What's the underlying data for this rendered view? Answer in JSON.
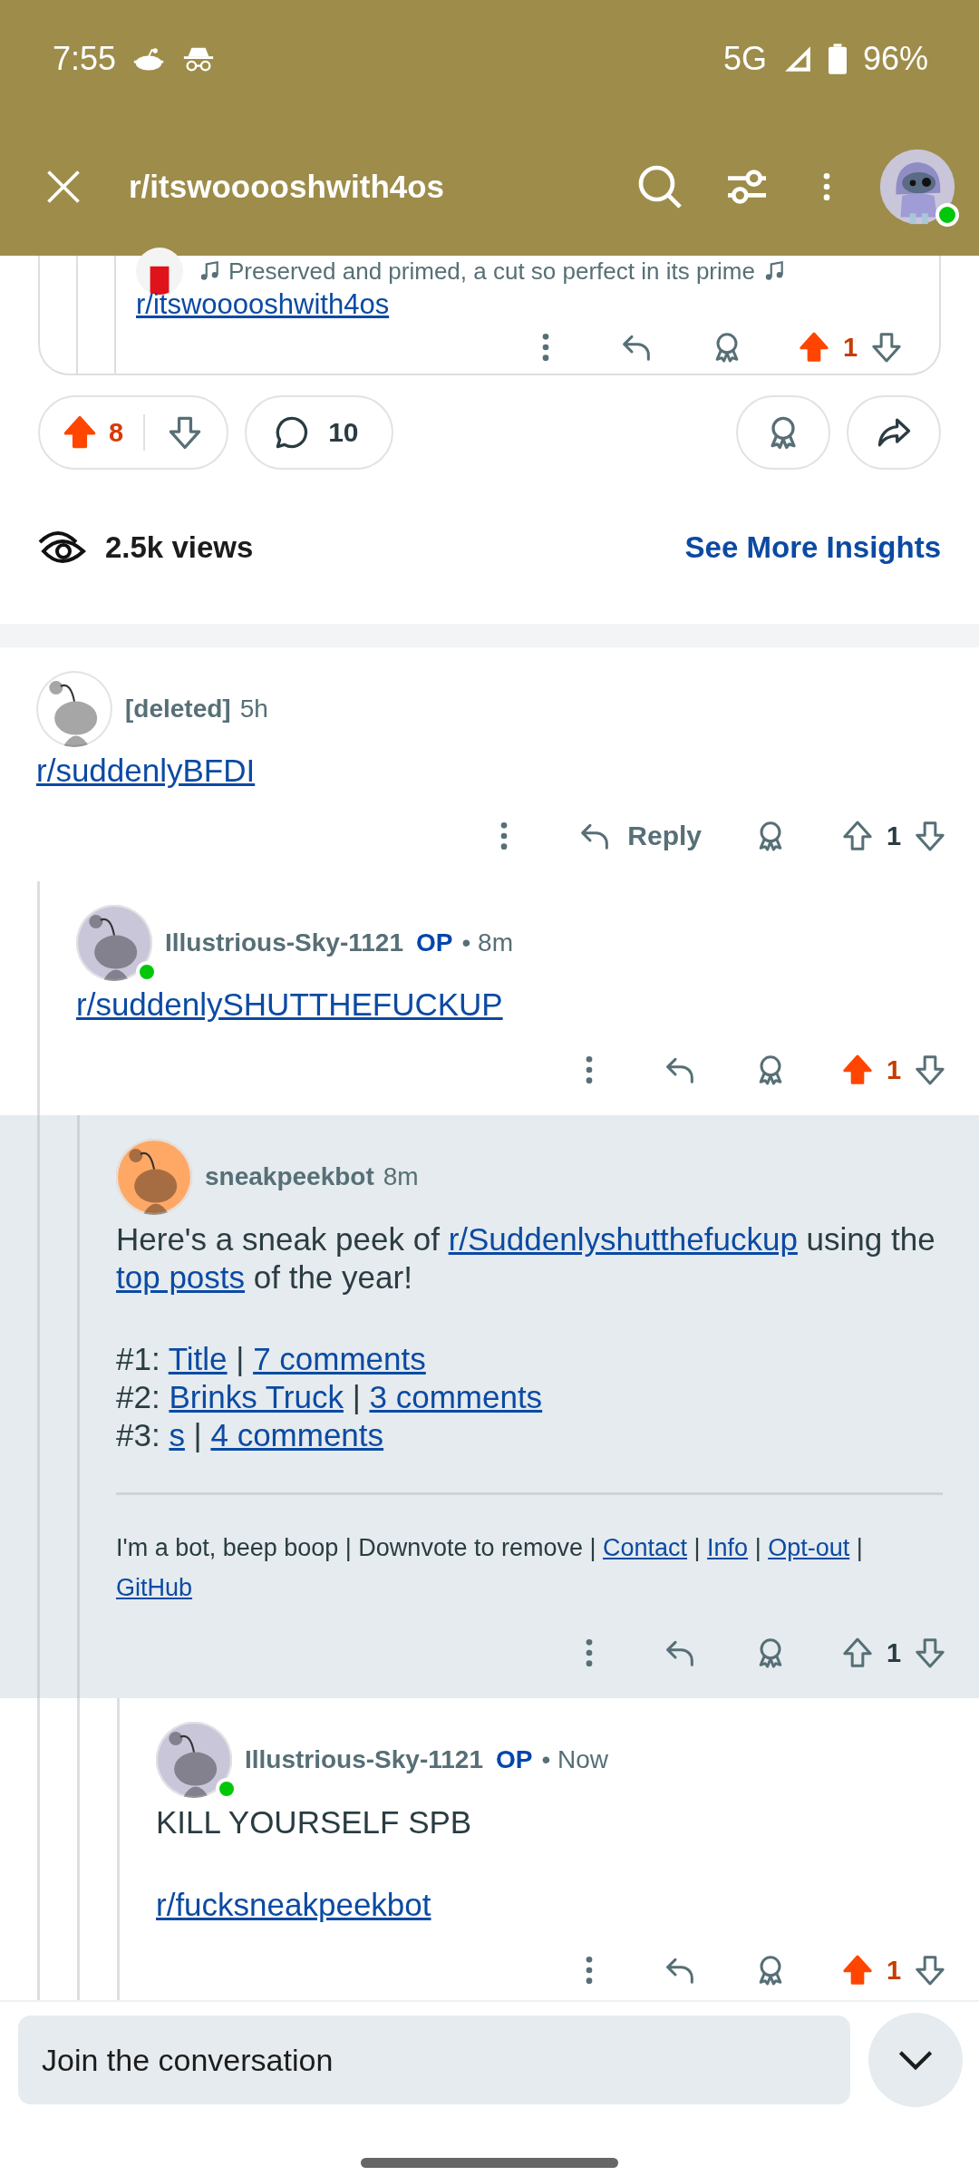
{
  "status_bar": {
    "time": "7:55",
    "network": "5G",
    "battery": "96%"
  },
  "header": {
    "title": "r/itswooooshwith4os",
    "online": true
  },
  "partial_comment": {
    "text": "Preserved and primed, a cut so perfect in its prime",
    "link": "r/itswooooshwith4os",
    "votes": "1",
    "upvoted": true
  },
  "post_actions": {
    "upvotes": "8",
    "upvoted": true,
    "comments": "10"
  },
  "insights": {
    "views": "2.5k views",
    "link": "See More Insights"
  },
  "comments": [
    {
      "author": "[deleted]",
      "avatar": {
        "color": "#ffffff"
      },
      "online": false,
      "time": "5h",
      "blocks": [
        {
          "kind": "link",
          "text": "r/suddenlyBFDI"
        }
      ],
      "reply_label": "Reply",
      "votes": "1",
      "upvoted": false,
      "highlighted": false,
      "children": [
        {
          "author": "Illustrious-Sky-1121",
          "avatar": {
            "color": "#c9c6da"
          },
          "online": true,
          "op": "OP",
          "time": "• 8m",
          "blocks": [
            {
              "kind": "link",
              "text": "r/suddenlySHUTTHEFUCKUP"
            }
          ],
          "votes": "1",
          "upvoted": true,
          "highlighted": false,
          "children": [
            {
              "author": "sneakpeekbot",
              "avatar": {
                "color": "#ffa866"
              },
              "online": false,
              "time": "8m",
              "blocks": [
                {
                  "kind": "paragraph",
                  "runs": [
                    {
                      "kind": "text",
                      "text": "Here's a sneak peek of "
                    },
                    {
                      "kind": "link",
                      "text": "r/Suddenlyshutthefuckup"
                    },
                    {
                      "kind": "text",
                      "text": " using the "
                    },
                    {
                      "kind": "link",
                      "text": "top posts"
                    },
                    {
                      "kind": "text",
                      "text": " of the year!"
                    }
                  ]
                },
                {
                  "kind": "lines",
                  "lines": [
                    [
                      {
                        "kind": "text",
                        "text": "#1: "
                      },
                      {
                        "kind": "link",
                        "text": "Title"
                      },
                      {
                        "kind": "text",
                        "text": " | "
                      },
                      {
                        "kind": "link",
                        "text": "7 comments"
                      }
                    ],
                    [
                      {
                        "kind": "text",
                        "text": "#2: "
                      },
                      {
                        "kind": "link",
                        "text": "Brinks Truck"
                      },
                      {
                        "kind": "text",
                        "text": " | "
                      },
                      {
                        "kind": "link",
                        "text": "3 comments"
                      }
                    ],
                    [
                      {
                        "kind": "text",
                        "text": "#3: "
                      },
                      {
                        "kind": "link",
                        "text": "s"
                      },
                      {
                        "kind": "text",
                        "text": " | "
                      },
                      {
                        "kind": "link",
                        "text": "4 comments"
                      }
                    ]
                  ]
                },
                {
                  "kind": "rule"
                },
                {
                  "kind": "small",
                  "runs": [
                    {
                      "kind": "text",
                      "text": "I'm a bot, beep boop | Downvote to remove | "
                    },
                    {
                      "kind": "link",
                      "text": "Contact"
                    },
                    {
                      "kind": "text",
                      "text": " | "
                    },
                    {
                      "kind": "link",
                      "text": "Info"
                    },
                    {
                      "kind": "text",
                      "text": " | "
                    },
                    {
                      "kind": "link",
                      "text": "Opt-out"
                    },
                    {
                      "kind": "text",
                      "text": " | "
                    },
                    {
                      "kind": "link",
                      "text": "GitHub"
                    }
                  ]
                }
              ],
              "votes": "1",
              "upvoted": false,
              "highlighted": true,
              "children": [
                {
                  "author": "Illustrious-Sky-1121",
                  "avatar": {
                    "color": "#c9c6da"
                  },
                  "online": true,
                  "op": "OP",
                  "time": "• Now",
                  "blocks": [
                    {
                      "kind": "paragraph",
                      "runs": [
                        {
                          "kind": "text",
                          "text": "KILL YOURSELF SPB"
                        }
                      ]
                    },
                    {
                      "kind": "link",
                      "text": "r/fucksneakpeekbot"
                    }
                  ],
                  "votes": "1",
                  "upvoted": true,
                  "highlighted": false
                }
              ]
            }
          ]
        }
      ]
    }
  ],
  "composer": {
    "placeholder": "Join the conversation"
  }
}
